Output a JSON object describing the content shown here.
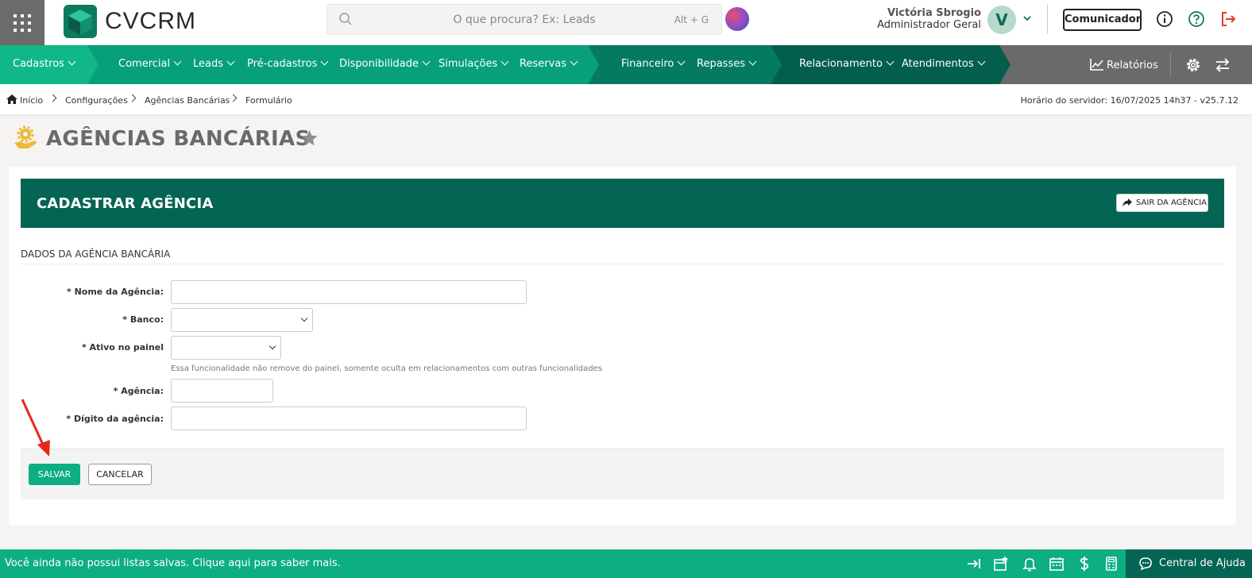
{
  "app": {
    "brand": "CVCRM"
  },
  "search": {
    "placeholder": "O que procura? Ex: Leads",
    "shortcut": "Alt + G"
  },
  "user": {
    "name": "Victória Sbrogio",
    "role": "Administrador Geral",
    "initial": "V"
  },
  "toolbar": {
    "comunicador_label": "Comunicador"
  },
  "nav": {
    "cadastros": "Cadastros",
    "comercial": "Comercial",
    "leads": "Leads",
    "pre_cadastros": "Pré-cadastros",
    "disponibilidade": "Disponibilidade",
    "simulacoes": "Simulações",
    "reservas": "Reservas",
    "financeiro": "Financeiro",
    "repasses": "Repasses",
    "relacionamento": "Relacionamento",
    "atendimentos": "Atendimentos",
    "relatorios": "Relatórios"
  },
  "breadcrumb": [
    "Início",
    "Configurações",
    "Agências Bancárias",
    "Formulário"
  ],
  "server_time": "Horário do servidor: 16/07/2025 14h37 - v25.7.12",
  "page": {
    "title": "AGÊNCIAS BANCÁRIAS"
  },
  "form": {
    "header_title": "CADASTRAR AGÊNCIA",
    "exit_label": "SAIR DA AGÊNCIA",
    "section_title": "DADOS DA AGÊNCIA BANCÁRIA",
    "fields": {
      "nome": {
        "label": "* Nome da Agência:",
        "value": ""
      },
      "banco": {
        "label": "* Banco:",
        "value": ""
      },
      "ativo": {
        "label": "* Ativo no painel",
        "value": ""
      },
      "ativo_help": "Essa funcionalidade não remove do painel, somente oculta em relacionamentos com outras funcionalidades",
      "agencia": {
        "label": "* Agência:",
        "value": ""
      },
      "digito": {
        "label": "* Dígito da agência:",
        "value": ""
      }
    },
    "save_label": "SALVAR",
    "cancel_label": "CANCELAR"
  },
  "footer": {
    "message": "Você ainda não possui listas salvas. Clique aqui para saber mais.",
    "help_label": "Central de Ajuda"
  },
  "colors": {
    "primary_green": "#0dae82",
    "dark_green": "#056554",
    "nav_gray": "#6a6a6a",
    "accent_red": "#e53935"
  }
}
